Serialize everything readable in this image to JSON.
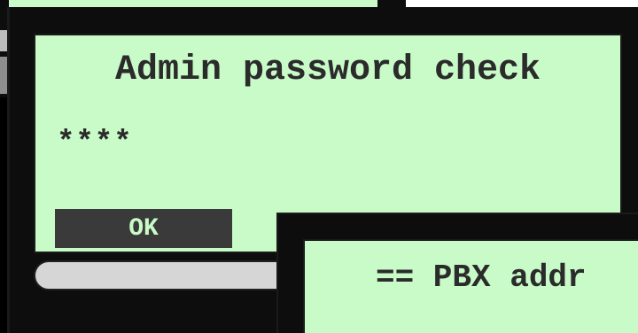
{
  "admin_dialog": {
    "title": "Admin password check",
    "password_value": "****",
    "ok_label": "OK"
  },
  "pbx_dialog": {
    "title": "== PBX addr"
  },
  "colors": {
    "panel_bg": "#c8fbc7",
    "frame": "#0d0d0d",
    "text": "#2b2b2b",
    "button_bg": "#3a3a3a"
  }
}
